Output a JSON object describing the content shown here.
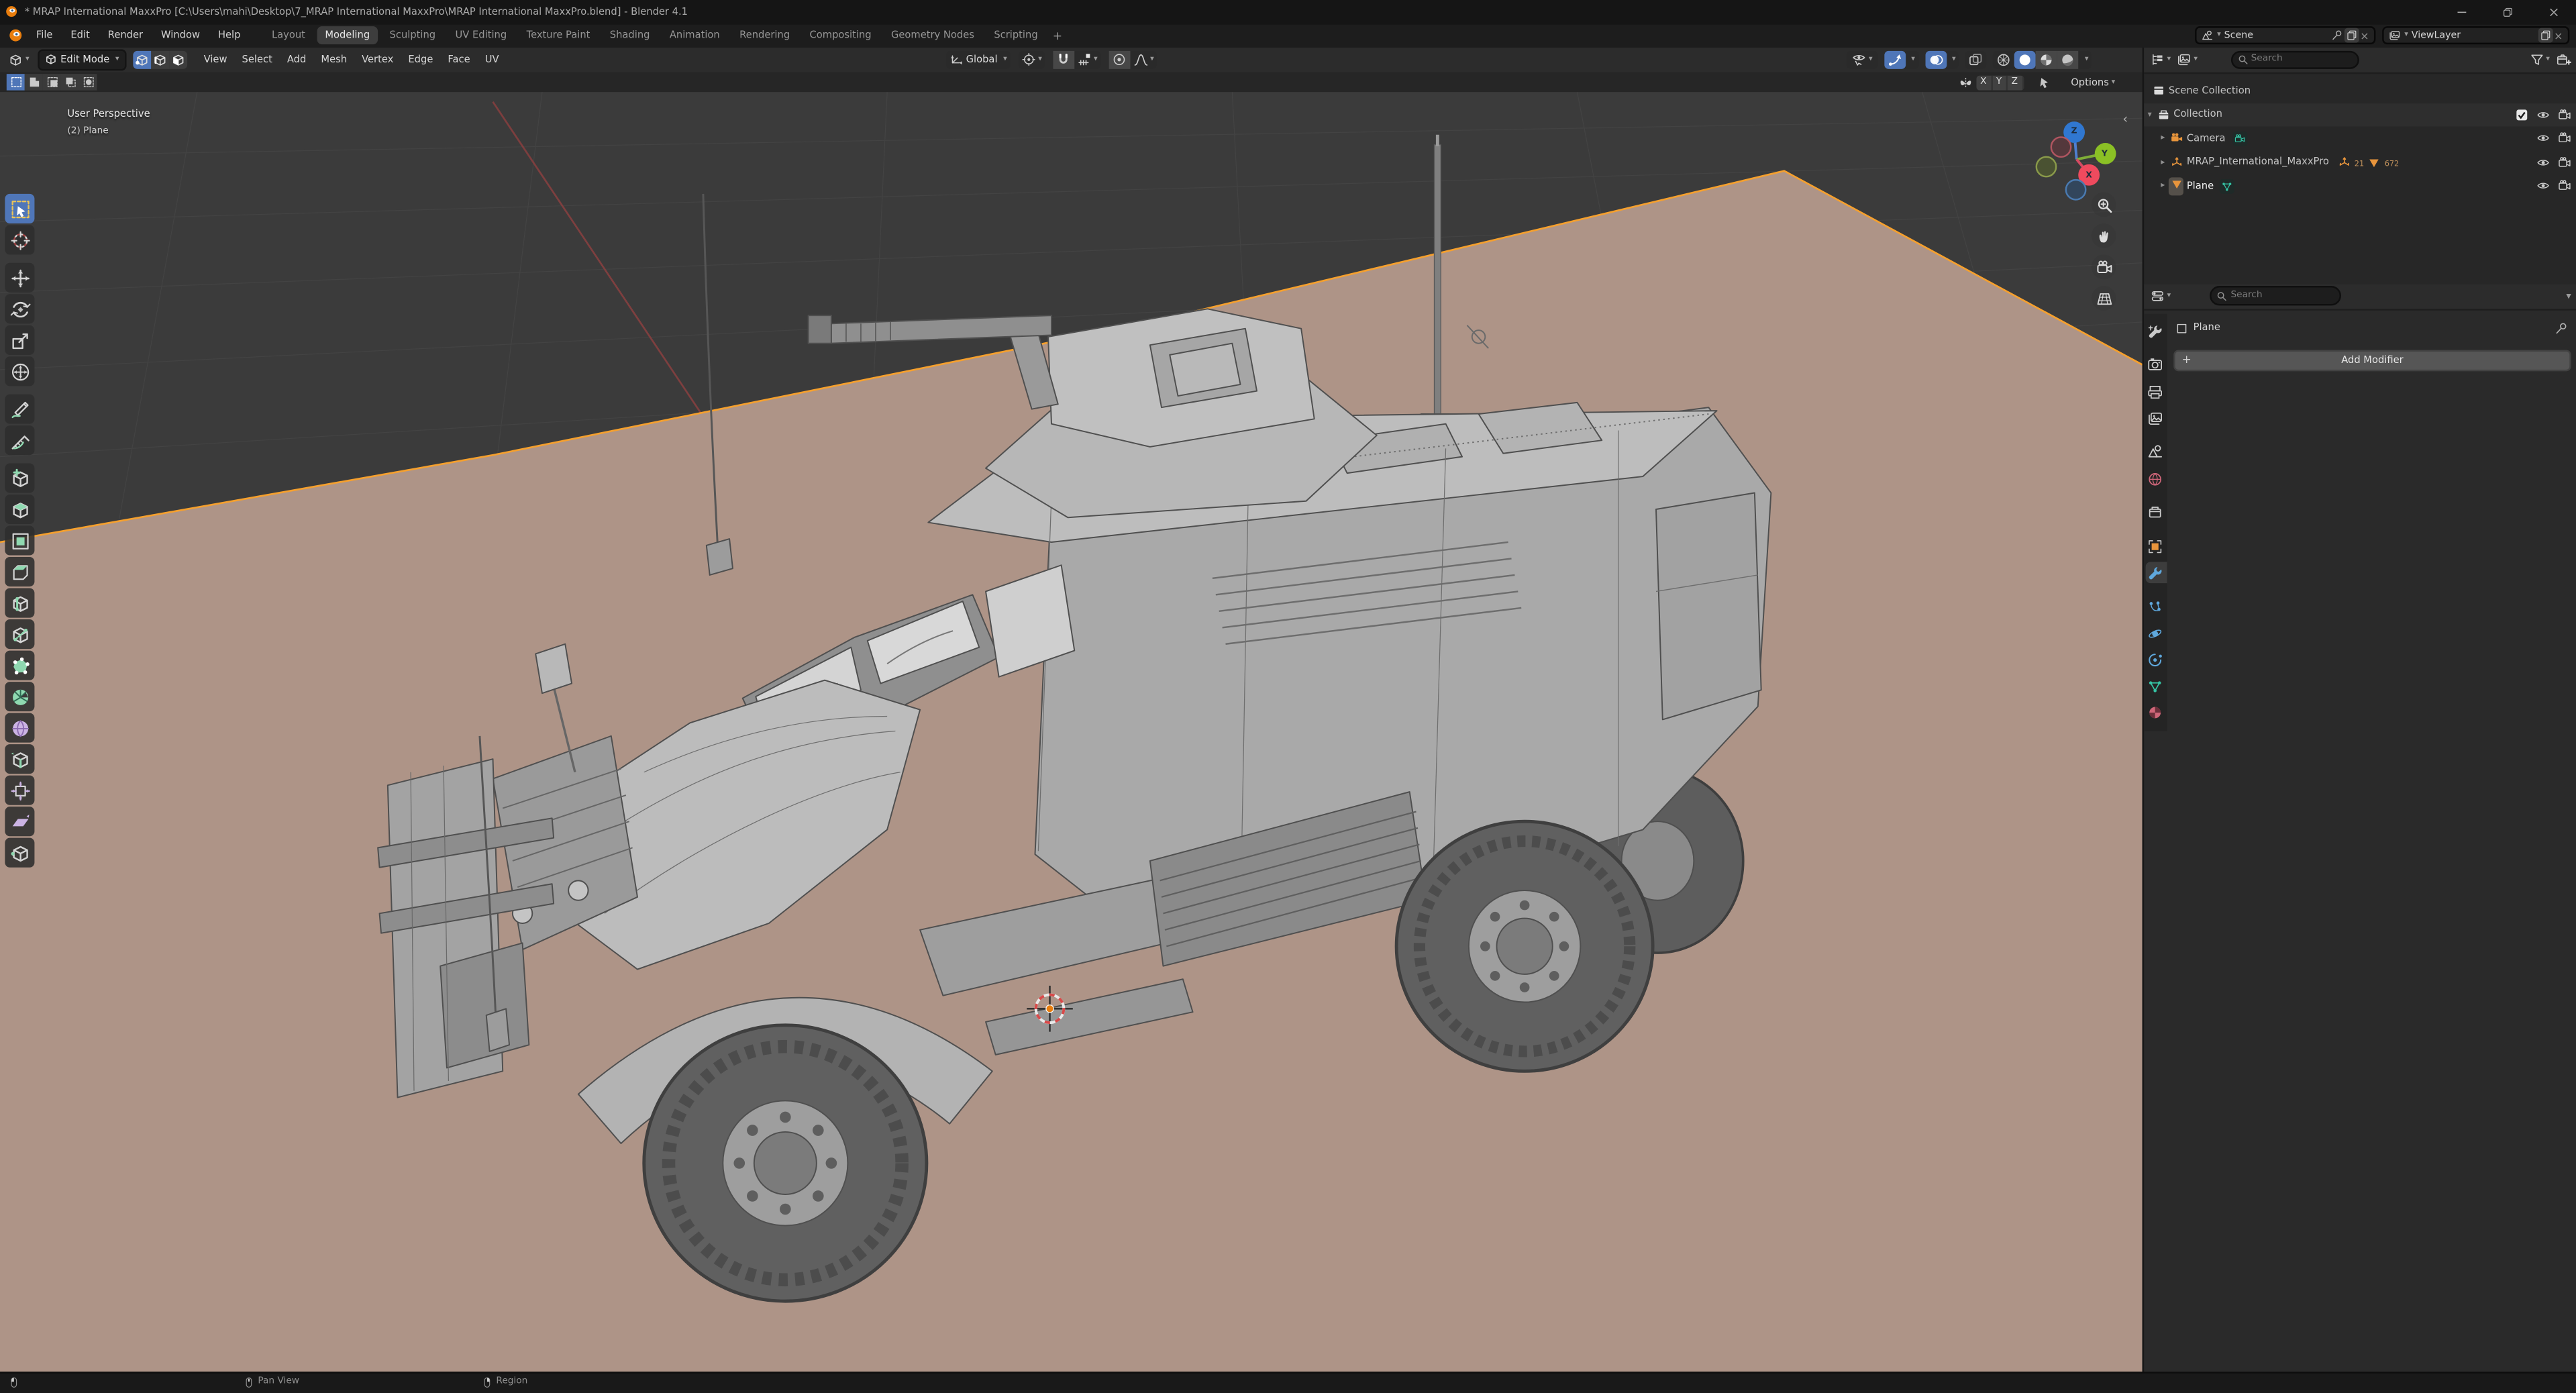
{
  "colors": {
    "accent_blue": "#4f76b8",
    "plane_tan": "#ae9487",
    "select_orange": "#f5a02e",
    "object_orange": "#e8953c",
    "data_green": "#35c4a5",
    "viewport_bg": "#3b3b3b"
  },
  "window": {
    "title": "* MRAP International MaxxPro [C:\\Users\\mahi\\Desktop\\7_MRAP International MaxxPro\\MRAP International MaxxPro.blend] - Blender 4.1"
  },
  "topbar": {
    "menus": [
      "File",
      "Edit",
      "Render",
      "Window",
      "Help"
    ],
    "workspaces": [
      {
        "label": "Layout"
      },
      {
        "label": "Modeling",
        "active": true
      },
      {
        "label": "Sculpting"
      },
      {
        "label": "UV Editing"
      },
      {
        "label": "Texture Paint"
      },
      {
        "label": "Shading"
      },
      {
        "label": "Animation"
      },
      {
        "label": "Rendering"
      },
      {
        "label": "Compositing"
      },
      {
        "label": "Geometry Nodes"
      },
      {
        "label": "Scripting"
      }
    ],
    "add_workspace": "+",
    "scene": {
      "label": "Scene",
      "close": "×"
    },
    "viewlayer": {
      "label": "ViewLayer",
      "close": "×"
    }
  },
  "viewport_header": {
    "mode": "Edit Mode",
    "menus": [
      "View",
      "Select",
      "Add",
      "Mesh",
      "Vertex",
      "Edge",
      "Face",
      "UV"
    ],
    "orientation": "Global",
    "chevron": "∨"
  },
  "tool_settings": {
    "mirror_axes": [
      "X",
      "Y",
      "Z"
    ],
    "options_label": "Options"
  },
  "toolbar": {
    "tools": [
      {
        "name": "select-box",
        "icon": "select-box",
        "active": true
      },
      {
        "name": "cursor",
        "icon": "cursor"
      },
      {
        "name": "move",
        "icon": "move",
        "gap": true
      },
      {
        "name": "rotate",
        "icon": "rotate"
      },
      {
        "name": "scale",
        "icon": "scale"
      },
      {
        "name": "transform",
        "icon": "transform"
      },
      {
        "name": "annotate",
        "icon": "annotate",
        "gap": true
      },
      {
        "name": "measure",
        "icon": "measure"
      },
      {
        "name": "add-cube",
        "icon": "add-cube",
        "gap": true
      },
      {
        "name": "extrude-region",
        "icon": "extrude"
      },
      {
        "name": "inset-faces",
        "icon": "inset"
      },
      {
        "name": "bevel",
        "icon": "bevel"
      },
      {
        "name": "loop-cut",
        "icon": "loop-cut"
      },
      {
        "name": "knife",
        "icon": "knife"
      },
      {
        "name": "poly-build",
        "icon": "poly-build"
      },
      {
        "name": "spin",
        "icon": "spin"
      },
      {
        "name": "smooth",
        "icon": "smooth"
      },
      {
        "name": "edge-slide",
        "icon": "edge-slide"
      },
      {
        "name": "shrink-fatten",
        "icon": "shrink-fatten"
      },
      {
        "name": "shear",
        "icon": "shear"
      },
      {
        "name": "rip-region",
        "icon": "rip"
      }
    ]
  },
  "viewport": {
    "view_label": "User Perspective",
    "object_label": "(2) Plane",
    "gizmo": {
      "x": "X",
      "y": "Y",
      "z": "Z"
    },
    "collapse_arrow": "‹"
  },
  "outliner": {
    "search_placeholder": "Search",
    "rows": [
      {
        "label": "Scene Collection"
      },
      {
        "label": "Collection"
      },
      {
        "label": "Camera"
      },
      {
        "label": "MRAP_International_MaxxPro",
        "counts": {
          "empties": "21",
          "meshes": "672"
        }
      },
      {
        "label": "Plane"
      }
    ]
  },
  "properties": {
    "search_placeholder": "Search",
    "tabs": [
      {
        "name": "tool",
        "icon": "tab-tool"
      },
      {
        "name": "render",
        "icon": "tab-render",
        "gap": true
      },
      {
        "name": "output",
        "icon": "tab-output"
      },
      {
        "name": "view-layer",
        "icon": "tab-viewlayer"
      },
      {
        "name": "scene",
        "icon": "tab-scene",
        "gap": true
      },
      {
        "name": "world",
        "icon": "tab-world"
      },
      {
        "name": "collection",
        "icon": "tab-collection",
        "gap": true
      },
      {
        "name": "object",
        "icon": "tab-object",
        "gap": true
      },
      {
        "name": "modifiers",
        "icon": "tab-modifier",
        "active": true
      },
      {
        "name": "particles",
        "icon": "tab-particles",
        "gap": true
      },
      {
        "name": "physics",
        "icon": "tab-physics"
      },
      {
        "name": "constraints",
        "icon": "tab-constraints"
      },
      {
        "name": "object-data",
        "icon": "tab-data"
      },
      {
        "name": "material",
        "icon": "tab-material"
      }
    ],
    "breadcrumb": "Plane",
    "add_modifier_label": "Add Modifier",
    "plus": "+"
  },
  "statusbar": {
    "hints": [
      {
        "label": "Pan View"
      },
      {
        "label": "Region"
      }
    ]
  }
}
